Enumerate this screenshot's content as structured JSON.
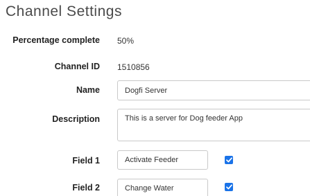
{
  "title": "Channel Settings",
  "percentage": {
    "label": "Percentage complete",
    "value": "50%"
  },
  "channel_id": {
    "label": "Channel ID",
    "value": "1510856"
  },
  "name": {
    "label": "Name",
    "value": "Dogfi Server"
  },
  "description": {
    "label": "Description",
    "value": "This is a server for Dog feeder App"
  },
  "fields": [
    {
      "label": "Field 1",
      "value": "Activate Feeder",
      "checked": true
    },
    {
      "label": "Field 2",
      "value": "Change Water",
      "checked": true
    }
  ],
  "colors": {
    "checkbox": "#1a73e8",
    "input_border": "#c9c9c9"
  }
}
